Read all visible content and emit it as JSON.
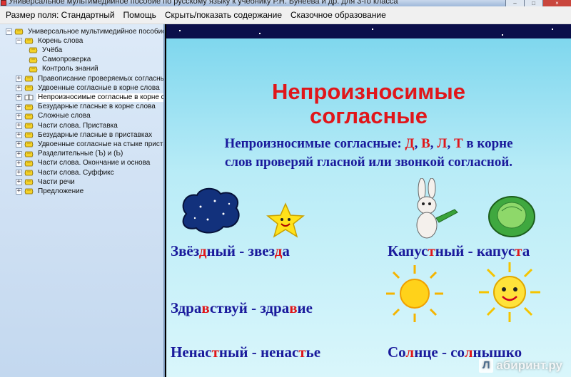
{
  "window": {
    "title": "Универсальное мультимедийное пособие по русскому языку к учебнику Р.Н. Бунеева и др. для 3-го класса",
    "buttons": [
      "–",
      "□",
      "×"
    ]
  },
  "menu": [
    "Размер поля: Стандартный",
    "Помощь",
    "Скрыть/показать содержание",
    "Сказочное образование"
  ],
  "tree": {
    "items": [
      {
        "label": "Универсальное мультимедийное пособие по",
        "level": 0,
        "expander": "−",
        "selected": false
      },
      {
        "label": "Корень слова",
        "level": 1,
        "expander": "−",
        "selected": false
      },
      {
        "label": "Учёба",
        "level": 2,
        "expander": "",
        "selected": false
      },
      {
        "label": "Самопроверка",
        "level": 2,
        "expander": "",
        "selected": false
      },
      {
        "label": "Контроль знаний",
        "level": 2,
        "expander": "",
        "selected": false
      },
      {
        "label": "Правописание проверяемых согласных в",
        "level": 1,
        "expander": "+",
        "selected": false
      },
      {
        "label": "Удвоенные согласные в корне слова",
        "level": 1,
        "expander": "+",
        "selected": false
      },
      {
        "label": "Непроизносимые согласные в корне сло",
        "level": 1,
        "expander": "+",
        "selected": true
      },
      {
        "label": "Безударные гласные в корне слова",
        "level": 1,
        "expander": "+",
        "selected": false
      },
      {
        "label": "Сложные слова",
        "level": 1,
        "expander": "+",
        "selected": false
      },
      {
        "label": "Части слова. Приставка",
        "level": 1,
        "expander": "+",
        "selected": false
      },
      {
        "label": "Безударные гласные в приставках",
        "level": 1,
        "expander": "+",
        "selected": false
      },
      {
        "label": "Удвоенные согласные на стыке пристав",
        "level": 1,
        "expander": "+",
        "selected": false
      },
      {
        "label": "Разделительные (Ъ) и (Ь)",
        "level": 1,
        "expander": "+",
        "selected": false
      },
      {
        "label": "Части слова. Окончание и основа",
        "level": 1,
        "expander": "+",
        "selected": false
      },
      {
        "label": "Части слова. Суффикс",
        "level": 1,
        "expander": "+",
        "selected": false
      },
      {
        "label": "Части речи",
        "level": 1,
        "expander": "+",
        "selected": false
      },
      {
        "label": "Предложение",
        "level": 1,
        "expander": "+",
        "selected": false
      }
    ]
  },
  "slide": {
    "heading_line1": "Непроизносимые",
    "heading_line2": "согласные",
    "rule_prefix": "Непроизносимые согласные: ",
    "rule_letters": [
      "Д",
      "В",
      "Л",
      "Т"
    ],
    "rule_sep": ", ",
    "rule_suffix": " в корне",
    "rule_line2": "слов проверяй гласной или звонкой согласной.",
    "pairs": [
      {
        "parts": [
          [
            "Звёз",
            0
          ],
          [
            "д",
            1
          ],
          [
            "ный - звез",
            0
          ],
          [
            "д",
            1
          ],
          [
            "а",
            0
          ]
        ]
      },
      {
        "parts": [
          [
            "Капус",
            0
          ],
          [
            "т",
            1
          ],
          [
            "ный - капус",
            0
          ],
          [
            "т",
            1
          ],
          [
            "а",
            0
          ]
        ]
      },
      {
        "parts": [
          [
            "Здра",
            0
          ],
          [
            "в",
            1
          ],
          [
            "ствуй - здра",
            0
          ],
          [
            "в",
            1
          ],
          [
            "ие",
            0
          ]
        ]
      },
      {
        "parts": [
          [
            "Ненас",
            0
          ],
          [
            "т",
            1
          ],
          [
            "ный - ненас",
            0
          ],
          [
            "т",
            1
          ],
          [
            "ье",
            0
          ]
        ]
      },
      {
        "parts": [
          [
            "Со",
            0
          ],
          [
            "л",
            1
          ],
          [
            "нце - со",
            0
          ],
          [
            "л",
            1
          ],
          [
            "нышко",
            0
          ]
        ]
      }
    ],
    "pictures": [
      "night-sky-cloud",
      "smiling-star",
      "hare-with-cucumber",
      "cabbage",
      "sun",
      "smiling-sun"
    ]
  },
  "watermark": {
    "badge": "Л",
    "text": "абиринт.ру"
  },
  "colors": {
    "accent_red": "#e0161a",
    "text_blue": "#1a1a9c",
    "panel_sky": "#7fd7ee"
  }
}
